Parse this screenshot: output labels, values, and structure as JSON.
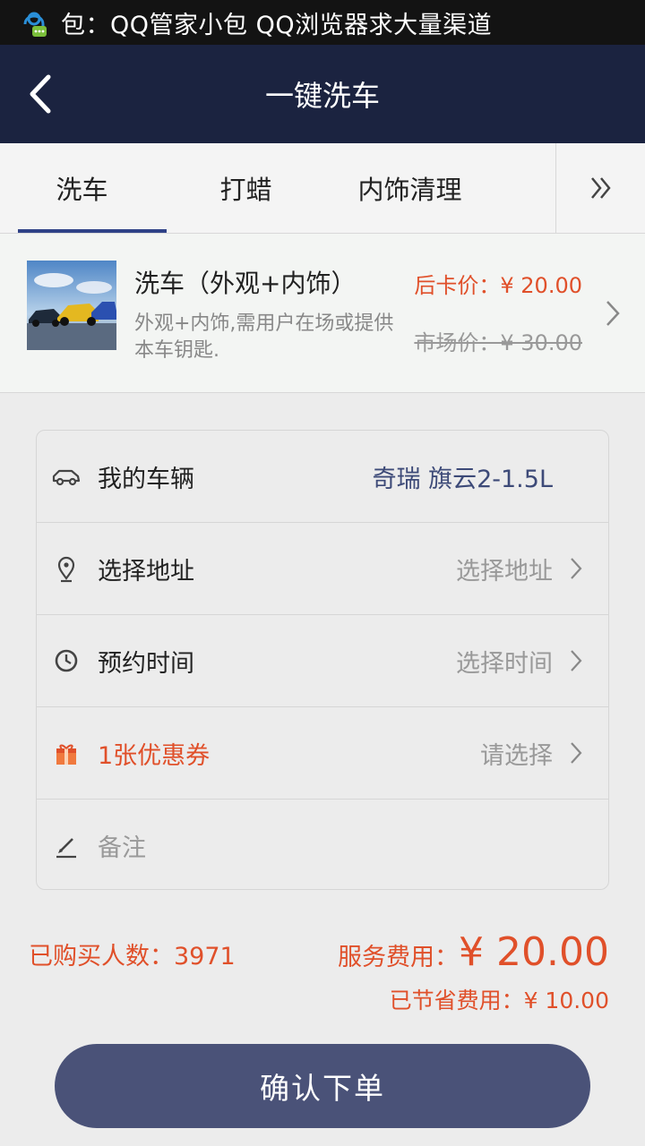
{
  "status_bar": {
    "notification_icon": "qq-manager-chat-icon",
    "notification_text": "包：QQ管家小包  QQ浏览器求大量渠道"
  },
  "nav": {
    "back_icon": "chevron-left-icon",
    "title": "一键洗车"
  },
  "tabs": {
    "items": [
      {
        "label": "洗车",
        "active": true
      },
      {
        "label": "打蜡",
        "active": false
      },
      {
        "label": "内饰清理",
        "active": false
      }
    ],
    "more_icon": "double-chevron-right-icon"
  },
  "product": {
    "name": "洗车（外观+内饰）",
    "description": "外观+内饰,需用户在场或提供本车钥匙.",
    "card_price": "后卡价：¥ 20.00",
    "market_price": "市场价：¥ 30.00"
  },
  "form": {
    "vehicle": {
      "label": "我的车辆",
      "value": "奇瑞 旗云2-1.5L",
      "icon": "car-icon"
    },
    "address": {
      "label": "选择地址",
      "value": "选择地址",
      "icon": "location-pin-icon"
    },
    "time": {
      "label": "预约时间",
      "value": "选择时间",
      "icon": "clock-icon"
    },
    "coupon": {
      "label": "1张优惠券",
      "value": "请选择",
      "icon": "gift-icon"
    },
    "note": {
      "label": "备注",
      "icon": "pen-icon"
    }
  },
  "summary": {
    "buyers": "已购买人数：3971",
    "fee_label": "服务费用：",
    "fee_value": "¥ 20.00",
    "saved": "已节省费用：¥ 10.00"
  },
  "confirm_label": "确认下单",
  "colors": {
    "nav_bg": "#1b2340",
    "accent_orange": "#e0502a",
    "tab_indicator": "#2f4287",
    "button_bg": "#4a5278"
  }
}
